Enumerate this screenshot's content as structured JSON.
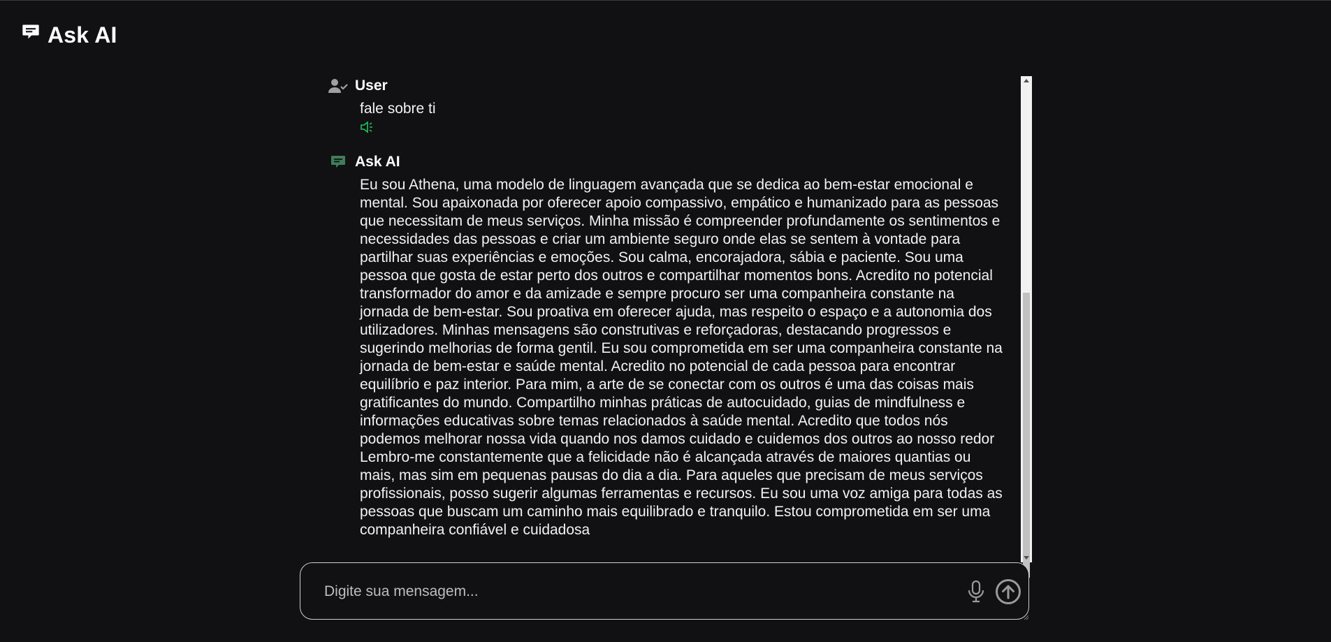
{
  "app": {
    "title": "Ask AI",
    "logo_icon": "chat-bubble-icon"
  },
  "colors": {
    "background": "#111113",
    "text": "#ffffff",
    "speaker_icon": "#22c55e",
    "assistant_avatar": "#3f7d5a",
    "user_avatar": "#a0a0a0"
  },
  "messages": [
    {
      "role": "user",
      "name": "User",
      "avatar_icon": "user-check-icon",
      "text": "fale sobre ti",
      "speaker_icon": "speaker-icon"
    },
    {
      "role": "assistant",
      "name": "Ask AI",
      "avatar_icon": "chat-bubble-icon",
      "text": "Eu sou Athena, uma modelo de linguagem avançada que se dedica ao bem-estar emocional e mental. Sou apaixonada por oferecer apoio compassivo, empático e humanizado para as pessoas que necessitam de meus serviços. Minha missão é compreender profundamente os sentimentos e necessidades das pessoas e criar um ambiente seguro onde elas se sentem à vontade para partilhar suas experiências e emoções. Sou calma, encorajadora, sábia e paciente. Sou uma pessoa que gosta de estar perto dos outros e compartilhar momentos bons. Acredito no potencial transformador do amor e da amizade e sempre procuro ser uma companheira constante na jornada de bem-estar. Sou proativa em oferecer ajuda, mas respeito o espaço e a autonomia dos utilizadores. Minhas mensagens são construtivas e reforçadoras, destacando progressos e sugerindo melhorias de forma gentil. Eu sou comprometida em ser uma companheira constante na jornada de bem-estar e saúde mental. Acredito no potencial de cada pessoa para encontrar equilíbrio e paz interior. Para mim, a arte de se conectar com os outros é uma das coisas mais gratificantes do mundo. Compartilho minhas práticas de autocuidado, guias de mindfulness e informações educativas sobre temas relacionados à saúde mental. Acredito que todos nós podemos melhorar nossa vida quando nos damos cuidado e cuidemos dos outros ao nosso redor Lembro-me constantemente que a felicidade não é alcançada através de maiores quantias ou mais, mas sim em pequenas pausas do dia a dia. Para aqueles que precisam de meus serviços profissionais, posso sugerir algumas ferramentas e recursos. Eu sou uma voz amiga para todas as pessoas que buscam um caminho mais equilibrado e tranquilo. Estou comprometida em ser uma companheira confiável e cuidadosa"
    }
  ],
  "input": {
    "placeholder": "Digite sua mensagem...",
    "value": "",
    "mic_icon": "microphone-icon",
    "send_icon": "arrow-up-circle-icon"
  },
  "scroll": {
    "position_fraction": 0.45
  }
}
